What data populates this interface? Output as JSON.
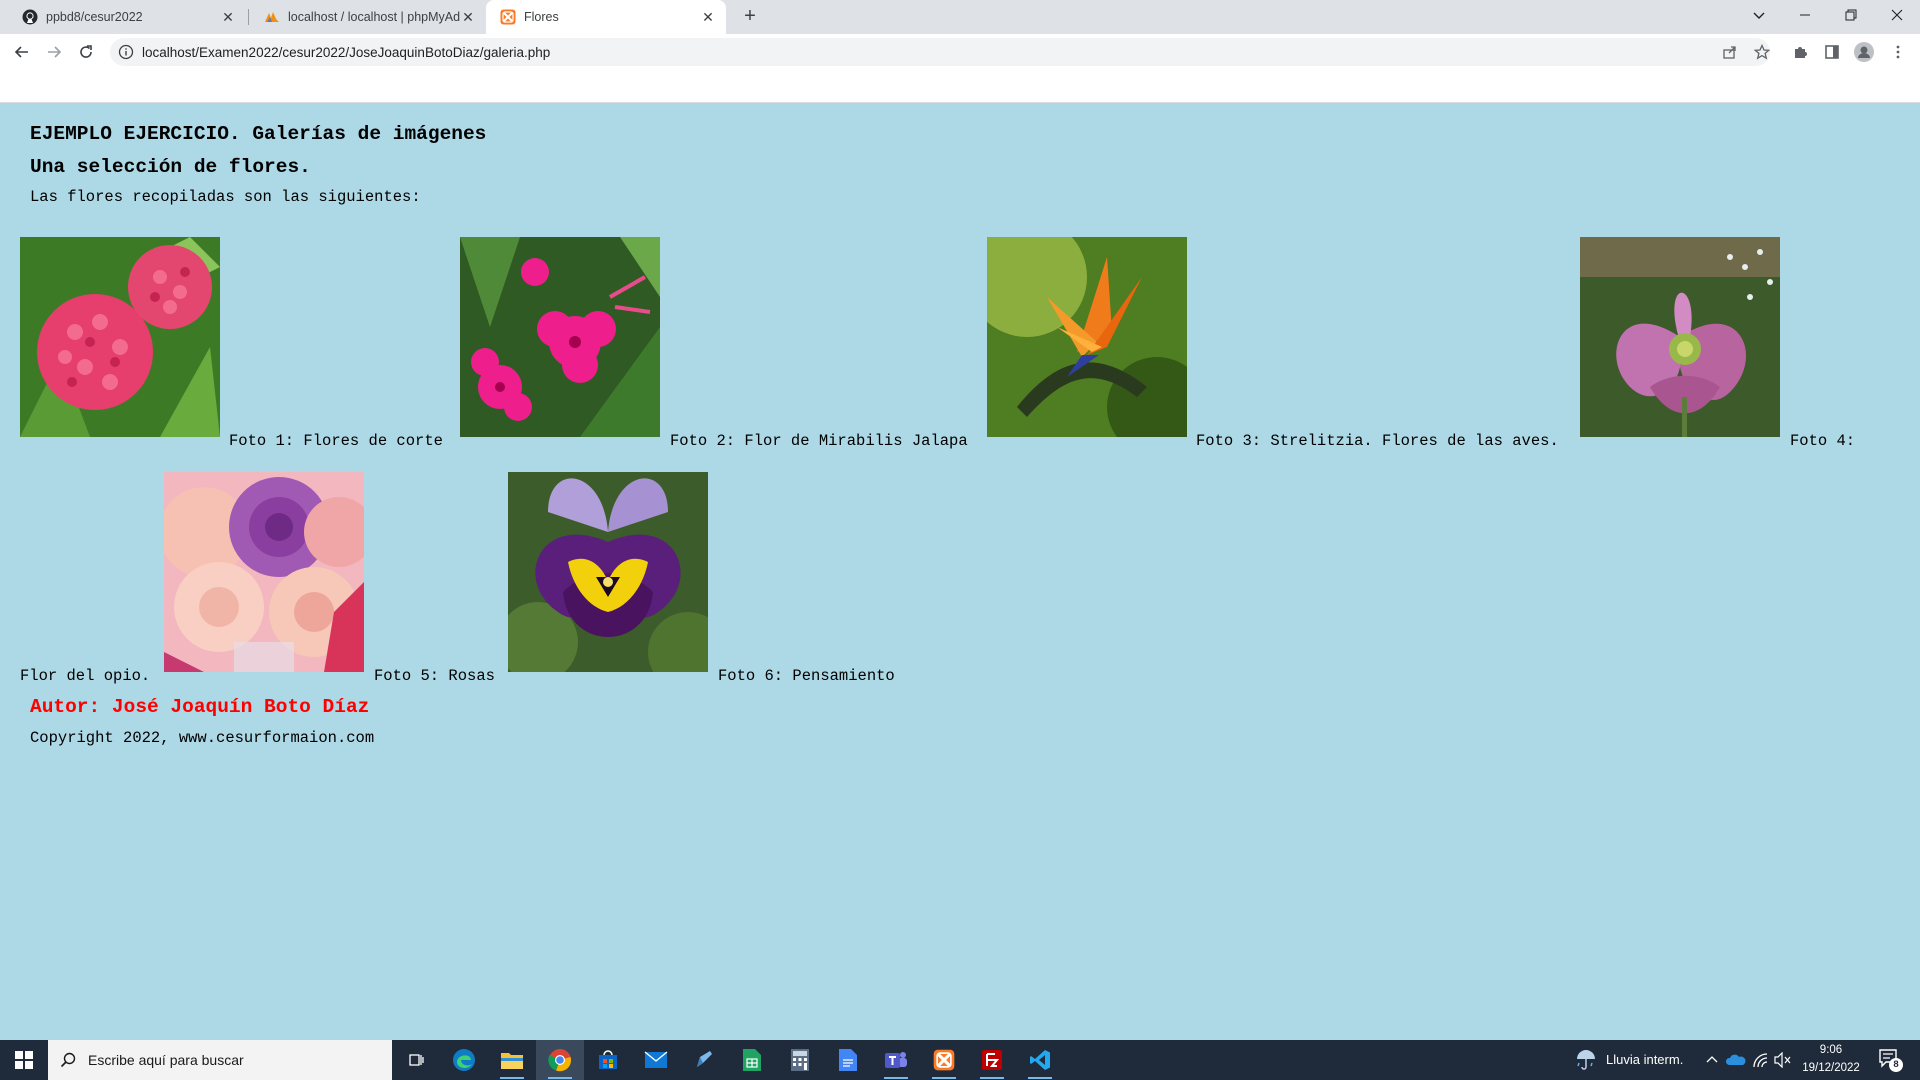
{
  "browser": {
    "tabs": [
      {
        "title": "ppbd8/cesur2022",
        "favicon": "github-icon",
        "active": false
      },
      {
        "title": "localhost / localhost | phpMyAdmin",
        "favicon": "phpmyadmin-icon",
        "active": false
      },
      {
        "title": "Flores",
        "favicon": "xampp-icon",
        "active": true
      }
    ],
    "address": "localhost/Examen2022/cesur2022/JoseJoaquinBotoDiaz/galeria.php"
  },
  "page": {
    "heading": "EJEMPLO EJERCICIO. Galerías de imágenes",
    "subheading": "Una selección de flores.",
    "intro": "Las flores recopiladas son las siguientes:",
    "photos": [
      {
        "caption": "Foto 1: Flores de corte",
        "image": "pink hydrangea flowers"
      },
      {
        "caption": "Foto 2: Flor de Mirabilis Jalapa",
        "image": "magenta mirabilis jalapa flowers"
      },
      {
        "caption": "Foto 3: Strelitzia. Flores de las aves.",
        "image": "orange bird of paradise flower"
      },
      {
        "caption_line1": "Foto 4:",
        "caption_line2": "Flor del opio.",
        "image": "pink opium poppy"
      },
      {
        "caption": "Foto 5: Rosas",
        "image": "bouquet of pink and purple roses"
      },
      {
        "caption": "Foto 6: Pensamiento",
        "image": "purple and yellow pansy"
      }
    ],
    "author": "Autor: José Joaquín Boto Díaz",
    "copyright": "Copyright 2022, www.cesurformaion.com",
    "colors": {
      "background": "#add8e6",
      "author": "#ff0000"
    }
  },
  "taskbar": {
    "search_placeholder": "Escribe aquí para buscar",
    "weather": "Lluvia interm.",
    "time": "9:06",
    "date": "19/12/2022",
    "notifications": "8"
  }
}
